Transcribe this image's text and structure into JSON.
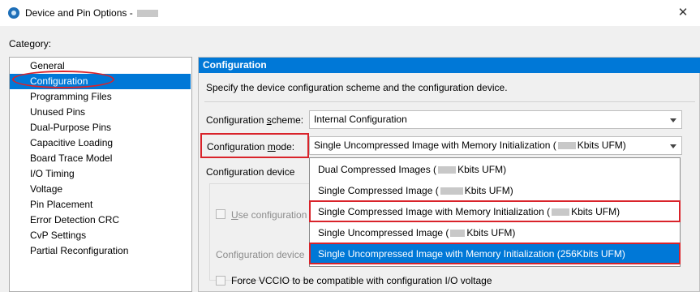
{
  "window": {
    "title": "Device and Pin Options - ",
    "close_glyph": "✕"
  },
  "category": {
    "label": "Category:",
    "items": [
      "General",
      "Configuration",
      "Programming Files",
      "Unused Pins",
      "Dual-Purpose Pins",
      "Capacitive Loading",
      "Board Trace Model",
      "I/O Timing",
      "Voltage",
      "Pin Placement",
      "Error Detection CRC",
      "CvP Settings",
      "Partial Reconfiguration"
    ],
    "selected": "Configuration"
  },
  "panel": {
    "header": "Configuration",
    "description": "Specify the device configuration scheme and the configuration device.",
    "scheme_label_pre": "Configuration ",
    "scheme_label_u": "s",
    "scheme_label_post": "cheme:",
    "scheme_value": "Internal Configuration",
    "mode_label_pre": "Configuration ",
    "mode_label_u": "m",
    "mode_label_post": "ode:",
    "mode_value_pre": "Single Uncompressed Image with Memory Initialization (",
    "mode_value_post": "Kbits UFM)",
    "config_device_group": "Configuration device",
    "use_config_pre": "",
    "use_config_u": "U",
    "use_config_post": "se configuration",
    "config_device_label": "Configuration device",
    "force_vccio": "Force VCCIO to be compatible with configuration I/O voltage"
  },
  "dropdown": {
    "options": [
      {
        "pre": "Dual Compressed Images (",
        "post": "Kbits UFM)"
      },
      {
        "pre": "Single Compressed Image (",
        "post": "Kbits UFM)"
      },
      {
        "pre": "Single Compressed Image with Memory Initialization (",
        "post": "Kbits UFM)"
      },
      {
        "pre": "Single Uncompressed Image (",
        "post": "Kbits UFM)"
      },
      {
        "full": "Single Uncompressed Image with Memory Initialization (256Kbits UFM)"
      }
    ]
  },
  "colors": {
    "accent": "#0078d7",
    "highlight_red": "#d9232a"
  }
}
